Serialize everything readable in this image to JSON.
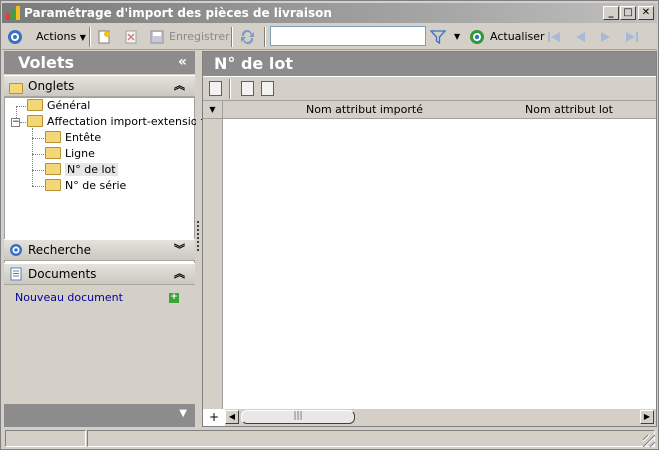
{
  "window": {
    "title": "Paramétrage d'import des pièces de livraison",
    "minimize": "_",
    "maximize": "□",
    "close": "✕"
  },
  "toolbar": {
    "actions_label": "Actions",
    "save_label": "Enregistrer",
    "search_value": "",
    "refresh_label": "Actualiser"
  },
  "left": {
    "header": "Volets",
    "collapse_glyph": "«",
    "tabs_section": "Onglets",
    "tree": {
      "general": "Général",
      "affectation": "Affectation import-extension",
      "entete": "Entête",
      "ligne": "Ligne",
      "lot": "N° de lot",
      "serie": "N° de série"
    },
    "search_section": "Recherche",
    "documents_section": "Documents",
    "new_document": "Nouveau document"
  },
  "main": {
    "title": "N° de lot",
    "columns": [
      "Nom attribut importé",
      "Nom attribut lot"
    ],
    "add_row": "+",
    "scroll_thumb": "|||"
  },
  "colors": {
    "header_bg": "#8c8c8c",
    "panel_bg": "#d4d0c8",
    "link": "#0000a0"
  }
}
